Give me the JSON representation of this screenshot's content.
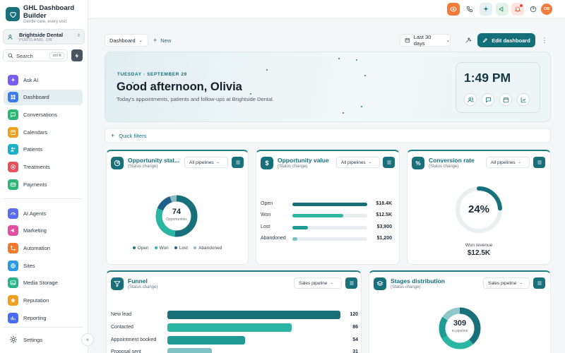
{
  "brand": {
    "title": "GHL Dashboard Builder",
    "tagline": "Gentle care, every visit."
  },
  "location": {
    "name": "Brightside Dental",
    "city": "PORTLAND, OR"
  },
  "search": {
    "placeholder": "Search",
    "shortcut": "ctrl K"
  },
  "nav": {
    "primary": [
      {
        "label": "Ask AI",
        "icon": "sparkle-icon",
        "color": "#7b5cf0"
      },
      {
        "label": "Dashboard",
        "icon": "dashboard-icon",
        "color": "#3f7be8",
        "active": true
      },
      {
        "label": "Conversations",
        "icon": "chat-icon",
        "color": "#2bb673"
      },
      {
        "label": "Calendars",
        "icon": "calendar-icon",
        "color": "#f0a020"
      },
      {
        "label": "Patients",
        "icon": "users-icon",
        "color": "#19b0c8"
      },
      {
        "label": "Treatments",
        "icon": "target-icon",
        "color": "#e8505b"
      },
      {
        "label": "Payments",
        "icon": "card-icon",
        "color": "#2bb673"
      }
    ],
    "secondary": [
      {
        "label": "AI Agents",
        "icon": "gauge-icon",
        "color": "#5b6cf0"
      },
      {
        "label": "Marketing",
        "icon": "megaphone-icon",
        "color": "#e04fa0"
      },
      {
        "label": "Automation",
        "icon": "workflow-icon",
        "color": "#f07a2a"
      },
      {
        "label": "Sites",
        "icon": "globe-icon",
        "color": "#2a9be0"
      },
      {
        "label": "Media Storage",
        "icon": "image-icon",
        "color": "#2bb38a"
      },
      {
        "label": "Reputation",
        "icon": "star-icon",
        "color": "#f0a020"
      },
      {
        "label": "Reporting",
        "icon": "chart-icon",
        "color": "#4a6cf0"
      }
    ],
    "settings": {
      "label": "Settings",
      "icon": "gear-icon"
    }
  },
  "topbar": {
    "avatar": "OB"
  },
  "toolbar": {
    "dashboard": "Dashboard",
    "new": "New",
    "date_range": "Last 30 days",
    "edit": "Edit dashboard"
  },
  "hero": {
    "date": "TUESDAY · SEPTEMBER 29",
    "greeting": "Good afternoon, Olivia",
    "subtitle": "Today's appointments, patients and follow-ups at Brightside Dental.",
    "time": "1:49 PM"
  },
  "quick_filters": "Quick filters",
  "cards": {
    "status": {
      "title": "Opportunity stat...",
      "subtitle": "(Status change)",
      "pipeline": "All pipelines",
      "total": "74",
      "total_label": "Opportunities",
      "legend": [
        {
          "label": "Open",
          "color": "#17707a"
        },
        {
          "label": "Won",
          "color": "#2bb5a3"
        },
        {
          "label": "Lost",
          "color": "#1d5f8a"
        },
        {
          "label": "Abandoned",
          "color": "#8fb8c2"
        }
      ]
    },
    "value": {
      "title": "Opportunity value",
      "subtitle": "(Status change)",
      "pipeline": "All pipelines",
      "rows": [
        {
          "label": "Open",
          "value": "$18.4K",
          "amount": 18400,
          "color": "#17707a"
        },
        {
          "label": "Won",
          "value": "$12.5K",
          "amount": 12500,
          "color": "#2bb5a3"
        },
        {
          "label": "Lost",
          "value": "$3,900",
          "amount": 3900,
          "color": "#1f9a94"
        },
        {
          "label": "Abandoned",
          "value": "$1,200",
          "amount": 1200,
          "color": "#7fc2c4"
        }
      ]
    },
    "conversion": {
      "title": "Conversion rate",
      "subtitle": "(Status change)",
      "pipeline": "All pipelines",
      "rate": "24%",
      "rate_value": 24,
      "revenue_label": "Won revenue",
      "revenue": "$12.5K"
    },
    "funnel": {
      "title": "Funnel",
      "subtitle": "(Status change)",
      "pipeline": "Sales pipeline",
      "rows": [
        {
          "label": "New lead",
          "value": "120",
          "count": 120,
          "color": "#17707a"
        },
        {
          "label": "Contacted",
          "value": "86",
          "count": 86,
          "color": "#2bb5a3"
        },
        {
          "label": "Appointment booked",
          "value": "54",
          "count": 54,
          "color": "#1f9a94"
        },
        {
          "label": "Proposal sent",
          "value": "31",
          "count": 31,
          "color": "#7fc2c4"
        }
      ]
    },
    "stages": {
      "title": "Stages distribution",
      "subtitle": "(Status change)",
      "pipeline": "Sales pipeline",
      "total": "309",
      "total_label": "in pipeline"
    }
  },
  "chart_data": [
    {
      "type": "pie",
      "title": "Opportunity status",
      "categories": [
        "Open",
        "Won",
        "Lost",
        "Abandoned"
      ],
      "values": [
        38,
        22,
        10,
        4
      ]
    },
    {
      "type": "bar",
      "title": "Opportunity value",
      "categories": [
        "Open",
        "Won",
        "Lost",
        "Abandoned"
      ],
      "values": [
        18400,
        12500,
        3900,
        1200
      ]
    },
    {
      "type": "bar",
      "title": "Funnel",
      "categories": [
        "New lead",
        "Contacted",
        "Appointment booked",
        "Proposal sent"
      ],
      "values": [
        120,
        86,
        54,
        31
      ]
    },
    {
      "type": "pie",
      "title": "Stages distribution",
      "categories": [
        "New lead",
        "Contacted",
        "Appointment booked",
        "Proposal sent"
      ],
      "values": [
        120,
        86,
        54,
        49
      ]
    }
  ]
}
